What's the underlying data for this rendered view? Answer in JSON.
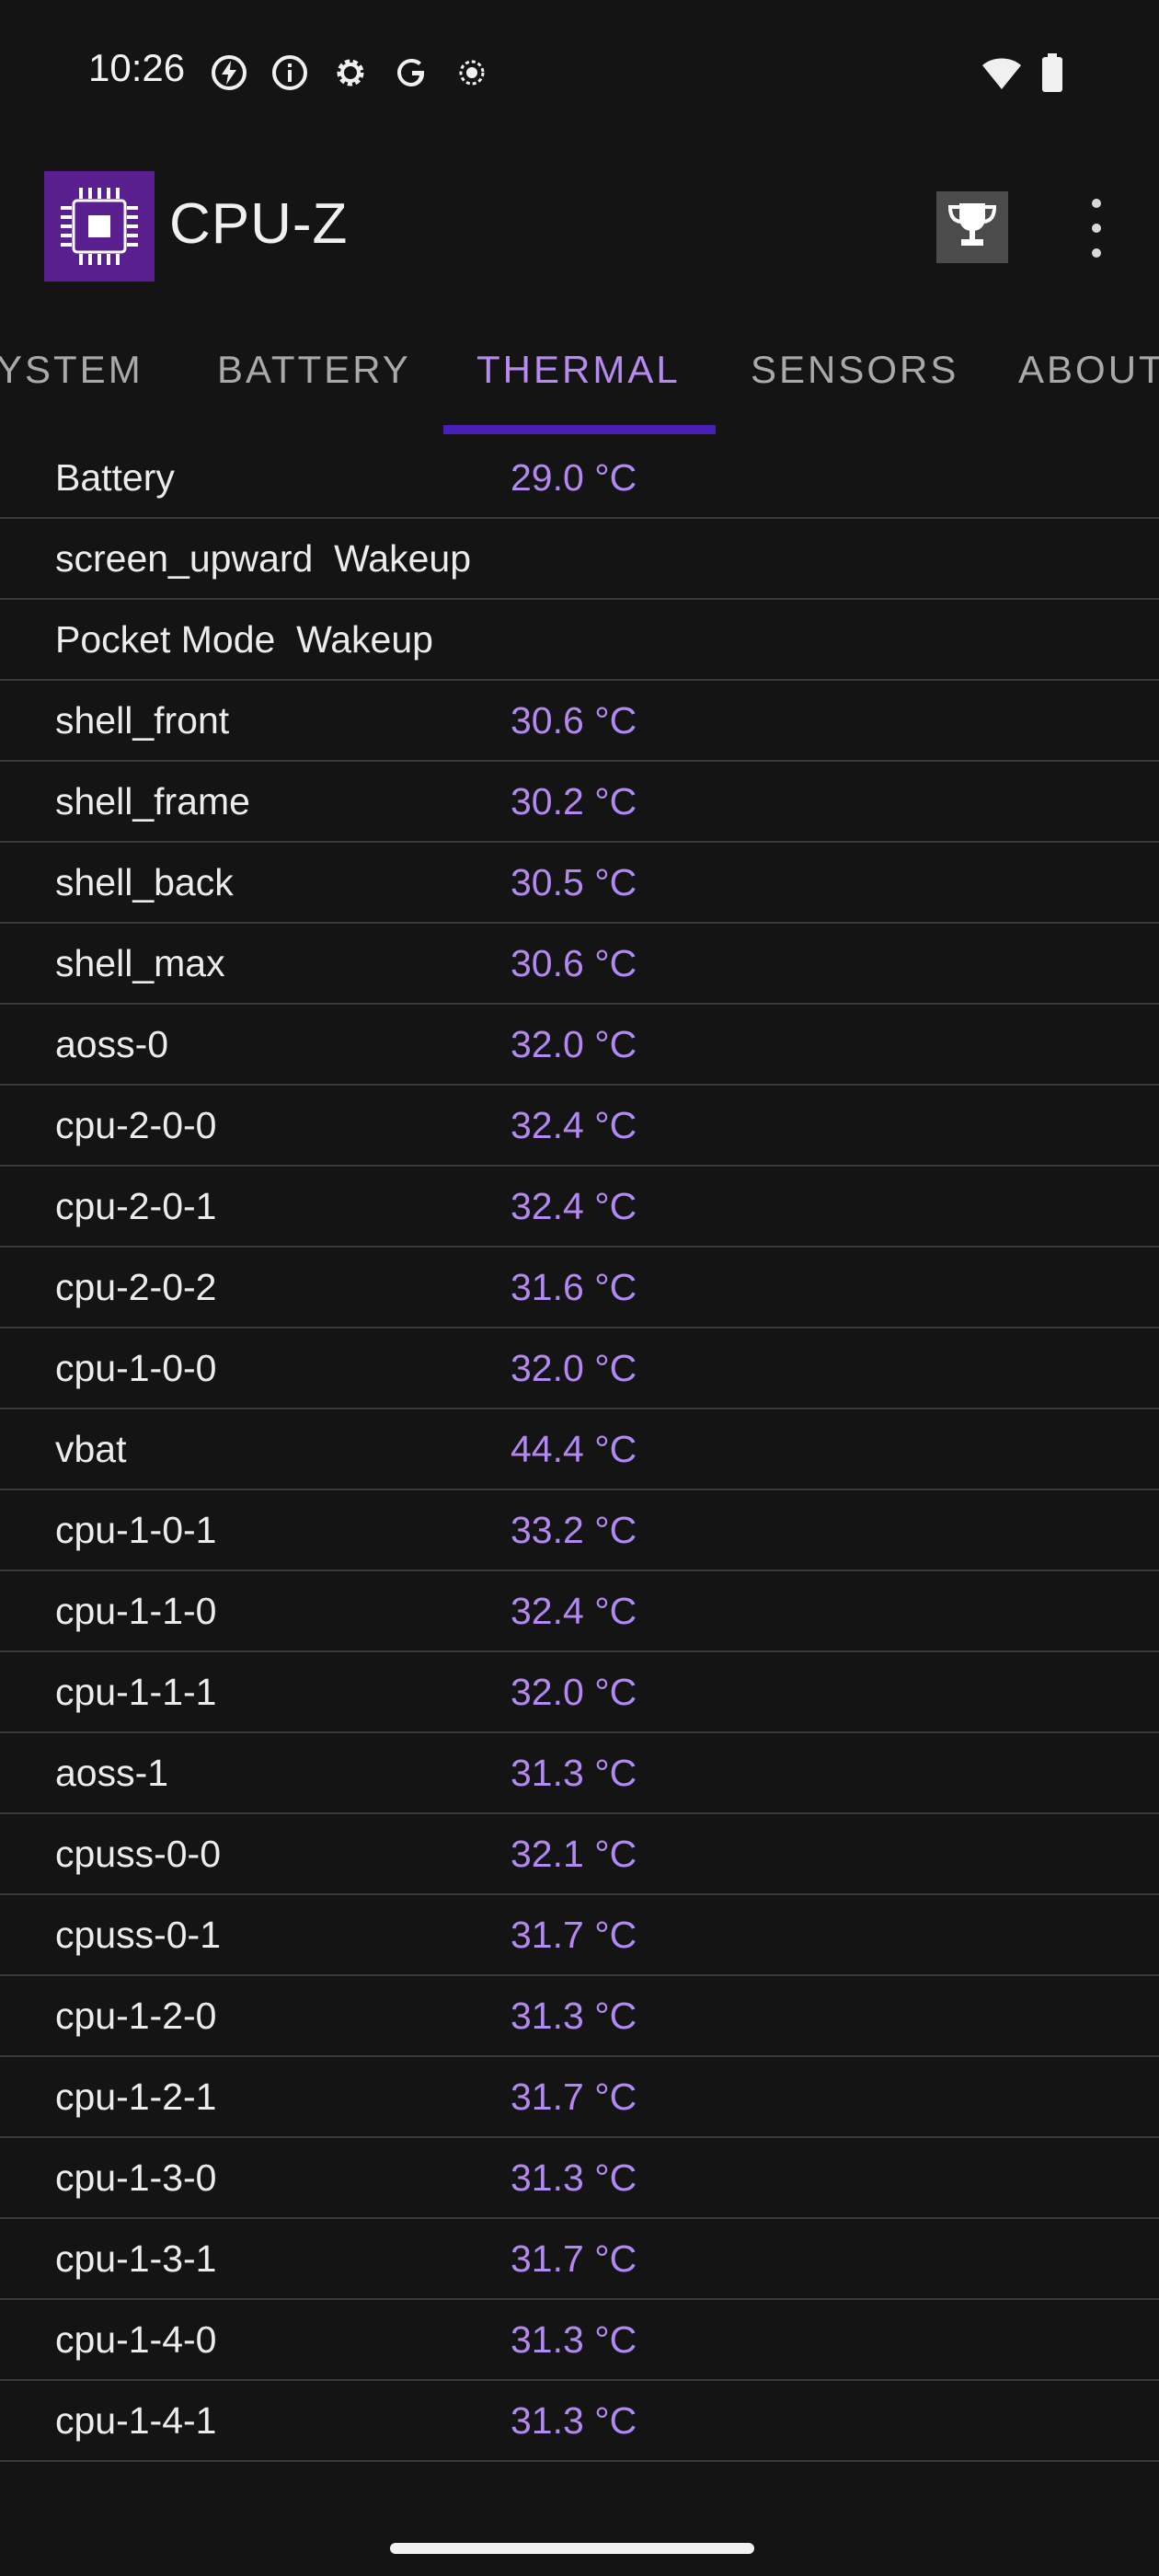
{
  "status_bar": {
    "time": "10:26",
    "left_icons": [
      "charging-icon",
      "info-icon",
      "settings-icon",
      "google-icon",
      "record-icon"
    ],
    "right_icons": [
      "wifi-icon",
      "battery-icon"
    ]
  },
  "app_bar": {
    "title": "CPU-Z",
    "logo_icon": "chip-icon",
    "trophy_icon": "trophy-icon",
    "menu_icon": "more-vert-icon"
  },
  "tabs": [
    {
      "label": "YSTEM",
      "active": false
    },
    {
      "label": "BATTERY",
      "active": false
    },
    {
      "label": "THERMAL",
      "active": true
    },
    {
      "label": "SENSORS",
      "active": false
    },
    {
      "label": "ABOUT",
      "active": false
    }
  ],
  "thermal": [
    {
      "name": "Battery",
      "value": "29.0 °C"
    },
    {
      "name": "screen_upward  Wakeup",
      "value": ""
    },
    {
      "name": "Pocket Mode  Wakeup",
      "value": ""
    },
    {
      "name": "shell_front",
      "value": "30.6 °C"
    },
    {
      "name": "shell_frame",
      "value": "30.2 °C"
    },
    {
      "name": "shell_back",
      "value": "30.5 °C"
    },
    {
      "name": "shell_max",
      "value": "30.6 °C"
    },
    {
      "name": "aoss-0",
      "value": "32.0 °C"
    },
    {
      "name": "cpu-2-0-0",
      "value": "32.4 °C"
    },
    {
      "name": "cpu-2-0-1",
      "value": "32.4 °C"
    },
    {
      "name": "cpu-2-0-2",
      "value": "31.6 °C"
    },
    {
      "name": "cpu-1-0-0",
      "value": "32.0 °C"
    },
    {
      "name": "vbat",
      "value": "44.4 °C"
    },
    {
      "name": "cpu-1-0-1",
      "value": "33.2 °C"
    },
    {
      "name": "cpu-1-1-0",
      "value": "32.4 °C"
    },
    {
      "name": "cpu-1-1-1",
      "value": "32.0 °C"
    },
    {
      "name": "aoss-1",
      "value": "31.3 °C"
    },
    {
      "name": "cpuss-0-0",
      "value": "32.1 °C"
    },
    {
      "name": "cpuss-0-1",
      "value": "31.7 °C"
    },
    {
      "name": "cpu-1-2-0",
      "value": "31.3 °C"
    },
    {
      "name": "cpu-1-2-1",
      "value": "31.7 °C"
    },
    {
      "name": "cpu-1-3-0",
      "value": "31.3 °C"
    },
    {
      "name": "cpu-1-3-1",
      "value": "31.7 °C"
    },
    {
      "name": "cpu-1-4-0",
      "value": "31.3 °C"
    },
    {
      "name": "cpu-1-4-1",
      "value": "31.3 °C"
    }
  ],
  "colors": {
    "background": "#141414",
    "accent": "#b388f0",
    "tab_indicator": "#4a1fb8",
    "logo_bg": "#5a1f8f",
    "divider": "#3a3a3a"
  }
}
